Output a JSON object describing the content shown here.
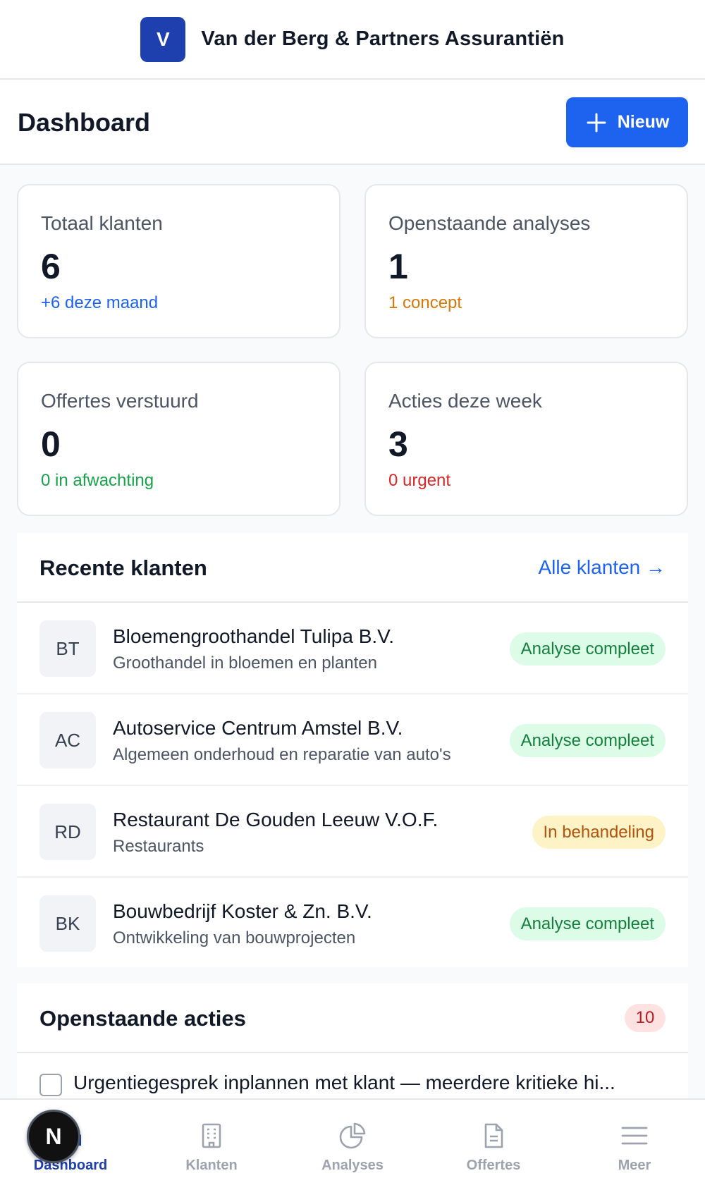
{
  "brand": {
    "logo_letter": "V",
    "name": "Van der Berg & Partners Assurantiën"
  },
  "header": {
    "title": "Dashboard",
    "new_label": "Nieuw"
  },
  "stats": [
    {
      "label": "Totaal klanten",
      "value": "6",
      "sub": "+6 deze maand",
      "sub_color": "#1d63f0"
    },
    {
      "label": "Openstaande analyses",
      "value": "1",
      "sub": "1 concept",
      "sub_color": "#d97706"
    },
    {
      "label": "Offertes verstuurd",
      "value": "0",
      "sub": "0 in afwachting",
      "sub_color": "#16a34a"
    },
    {
      "label": "Acties deze week",
      "value": "3",
      "sub": "0 urgent",
      "sub_color": "#dc2626"
    }
  ],
  "recent": {
    "title": "Recente klanten",
    "link": "Alle klanten →",
    "clients": [
      {
        "initials": "BT",
        "name": "Bloemengroothandel Tulipa B.V.",
        "desc": "Groothandel in bloemen en planten",
        "status": "Analyse compleet",
        "status_type": "green"
      },
      {
        "initials": "AC",
        "name": "Autoservice Centrum Amstel B.V.",
        "desc": "Algemeen onderhoud en reparatie van auto's",
        "status": "Analyse compleet",
        "status_type": "green"
      },
      {
        "initials": "RD",
        "name": "Restaurant De Gouden Leeuw V.O.F.",
        "desc": "Restaurants",
        "status": "In behandeling",
        "status_type": "amber"
      },
      {
        "initials": "BK",
        "name": "Bouwbedrijf Koster & Zn. B.V.",
        "desc": "Ontwikkeling van bouwprojecten",
        "status": "Analyse compleet",
        "status_type": "green"
      }
    ]
  },
  "actions": {
    "title": "Openstaande acties",
    "count": "10",
    "items": [
      {
        "text": "Urgentiegesprek inplannen met klant — meerdere kritieke hi..."
      }
    ]
  },
  "nav": {
    "items": [
      {
        "label": "Dashboard",
        "icon": "home-icon",
        "active": true
      },
      {
        "label": "Klanten",
        "icon": "building-icon"
      },
      {
        "label": "Analyses",
        "icon": "pie-chart-icon"
      },
      {
        "label": "Offertes",
        "icon": "document-icon"
      },
      {
        "label": "Meer",
        "icon": "menu-icon"
      }
    ]
  },
  "dev_badge": {
    "letter": "N"
  },
  "colors": {
    "primary": "#1d63f0",
    "brand": "#1e40af",
    "green": "#15803d",
    "amber": "#b45309",
    "red": "#b91c1c"
  }
}
